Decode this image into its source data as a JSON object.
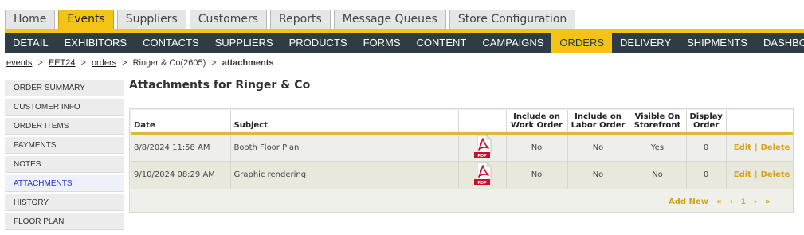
{
  "top_tabs": [
    {
      "label": "Home",
      "active": false
    },
    {
      "label": "Events",
      "active": true
    },
    {
      "label": "Suppliers",
      "active": false
    },
    {
      "label": "Customers",
      "active": false
    },
    {
      "label": "Reports",
      "active": false
    },
    {
      "label": "Message Queues",
      "active": false
    },
    {
      "label": "Store Configuration",
      "active": false
    }
  ],
  "main_nav": [
    {
      "label": "DETAIL",
      "active": false
    },
    {
      "label": "EXHIBITORS",
      "active": false
    },
    {
      "label": "CONTACTS",
      "active": false
    },
    {
      "label": "SUPPLIERS",
      "active": false
    },
    {
      "label": "PRODUCTS",
      "active": false
    },
    {
      "label": "FORMS",
      "active": false
    },
    {
      "label": "CONTENT",
      "active": false
    },
    {
      "label": "CAMPAIGNS",
      "active": false
    },
    {
      "label": "ORDERS",
      "active": true
    },
    {
      "label": "DELIVERY",
      "active": false
    },
    {
      "label": "SHIPMENTS",
      "active": false
    },
    {
      "label": "DASHBOARD",
      "active": false
    }
  ],
  "breadcrumb": {
    "events": "events",
    "event_code": "EET24",
    "orders": "orders",
    "order": "Ringer & Co(2605)",
    "current": "attachments",
    "separator": ">"
  },
  "sidebar": [
    {
      "label": "ORDER SUMMARY",
      "active": false
    },
    {
      "label": "CUSTOMER INFO",
      "active": false
    },
    {
      "label": "ORDER ITEMS",
      "active": false
    },
    {
      "label": "PAYMENTS",
      "active": false
    },
    {
      "label": "NOTES",
      "active": false
    },
    {
      "label": "ATTACHMENTS",
      "active": true
    },
    {
      "label": "HISTORY",
      "active": false
    },
    {
      "label": "FLOOR PLAN",
      "active": false
    }
  ],
  "page_title": "Attachments for Ringer & Co",
  "table": {
    "headers": {
      "date": "Date",
      "subject": "Subject",
      "file": "",
      "work_order": "Include on Work Order",
      "labor_order": "Include on Labor Order",
      "storefront": "Visible On Storefront",
      "display_order": "Display Order",
      "actions": ""
    },
    "rows": [
      {
        "date": "8/8/2024 11:58 AM",
        "subject": "Booth Floor Plan",
        "file_icon": "pdf-file-icon",
        "work_order": "No",
        "labor_order": "No",
        "storefront": "Yes",
        "display_order": "0",
        "edit": "Edit",
        "delete": "Delete"
      },
      {
        "date": "9/10/2024 08:29 AM",
        "subject": "Graphic rendering",
        "file_icon": "pdf-file-icon",
        "work_order": "No",
        "labor_order": "No",
        "storefront": "No",
        "display_order": "0",
        "edit": "Edit",
        "delete": "Delete"
      }
    ],
    "pdf_label": "PDF",
    "action_separator": "|",
    "add_new": "Add New",
    "pager": {
      "first": "«",
      "prev": "‹",
      "page": "1",
      "next": "›",
      "last": "»"
    }
  },
  "colors": {
    "accent": "#f5c316",
    "nav_bg": "#2f3c45",
    "link_gold": "#d4a417",
    "pdf_red": "#c8102e"
  }
}
